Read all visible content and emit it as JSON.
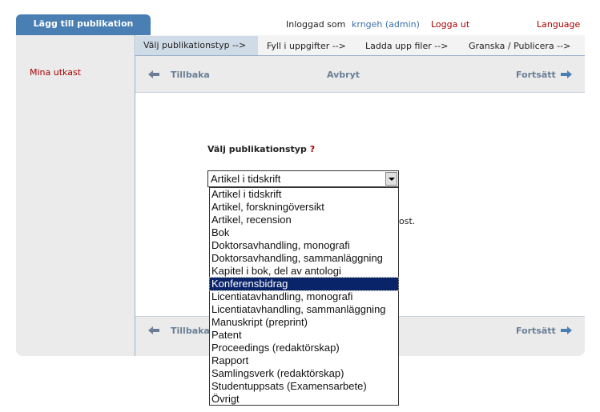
{
  "app_tab": "Lägg till publikation",
  "header": {
    "logged_in_as": "Inloggad som",
    "user": "krngeh (admin)",
    "logout": "Logga ut",
    "language": "Language"
  },
  "sidebar": {
    "drafts": "Mina utkast"
  },
  "steps": [
    "Välj publikationstyp -->",
    "Fyll i uppgifter -->",
    "Ladda upp filer -->",
    "Granska / Publicera -->"
  ],
  "nav": {
    "back": "Tillbaka",
    "cancel": "Avbryt",
    "next": "Fortsätt"
  },
  "form": {
    "label": "Välj publikationstyp",
    "help": "?",
    "selected": "Artikel i tidskrift",
    "partial_text": "ost."
  },
  "dropdown": {
    "highlighted_index": 7,
    "options": [
      "Artikel i tidskrift",
      "Artikel, forskningöversikt",
      "Artikel, recension",
      "Bok",
      "Doktorsavhandling, monografi",
      "Doktorsavhandling, sammanläggning",
      "Kapitel i bok, del av antologi",
      "Konferensbidrag",
      "Licentiatavhandling, monografi",
      "Licentiatavhandling, sammanläggning",
      "Manuskript (preprint)",
      "Patent",
      "Proceedings (redaktörskap)",
      "Rapport",
      "Samlingsverk (redaktörskap)",
      "Studentuppsats (Examensarbete)",
      "Övrigt"
    ]
  },
  "colors": {
    "tab": "#4a7fb4",
    "link_red": "#a80000",
    "link_blue": "#3a6fa7",
    "highlight": "#0a246a"
  }
}
